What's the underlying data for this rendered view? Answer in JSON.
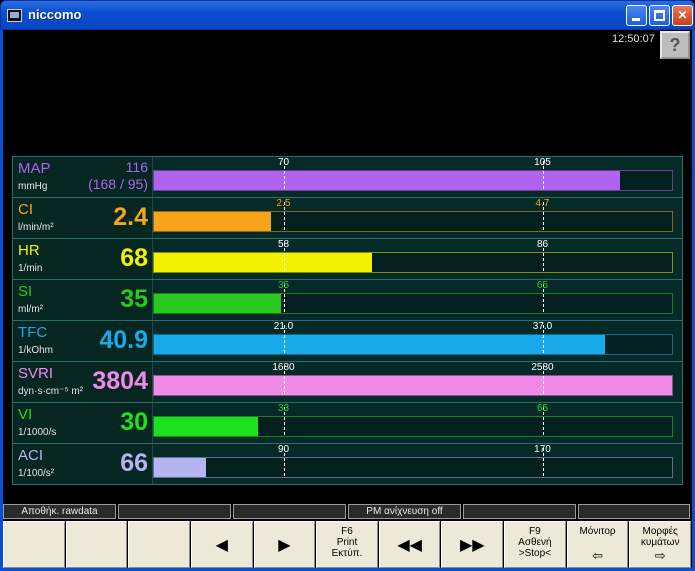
{
  "window": {
    "title": "niccomo"
  },
  "clock": "12:50:07",
  "help_label": "?",
  "parameters": [
    {
      "name": "MAP",
      "unit": "mmHg",
      "value": "116",
      "sub": "(168 / 95)",
      "color": "#b062f0",
      "thr1": "70",
      "thr2": "105",
      "fill_pct": 90,
      "thr1_pct": 25,
      "thr2_pct": 75
    },
    {
      "name": "CI",
      "unit": "l/min/m²",
      "value": "2.4",
      "color": "#f6a51a",
      "thr1": "2.5",
      "thr2": "4.7",
      "fill_pct": 22.5,
      "thr1_pct": 25,
      "thr2_pct": 75
    },
    {
      "name": "HR",
      "unit": "1/min",
      "value": "68",
      "color": "#f3f300",
      "thr1": "58",
      "thr2": "86",
      "fill_pct": 42,
      "thr1_pct": 25,
      "thr2_pct": 75
    },
    {
      "name": "SI",
      "unit": "ml/m²",
      "value": "35",
      "color": "#28c81e",
      "thr1": "35",
      "thr2": "65",
      "fill_pct": 24.5,
      "thr1_pct": 25,
      "thr2_pct": 75
    },
    {
      "name": "TFC",
      "unit": "1/kOhm",
      "value": "40.9",
      "color": "#18aaea",
      "thr1": "21.0",
      "thr2": "37.0",
      "fill_pct": 87,
      "thr1_pct": 25,
      "thr2_pct": 75
    },
    {
      "name": "SVRI",
      "unit": "dyn·s·cm⁻⁵ m²",
      "value": "3804",
      "color": "#f08ae8",
      "thr1": "1680",
      "thr2": "2580",
      "fill_pct": 100,
      "thr1_pct": 25,
      "thr2_pct": 75
    },
    {
      "name": "VI",
      "unit": "1/1000/s",
      "value": "30",
      "color": "#1ee01e",
      "thr1": "33",
      "thr2": "65",
      "fill_pct": 20,
      "thr1_pct": 25,
      "thr2_pct": 75
    },
    {
      "name": "ACI",
      "unit": "1/100/s²",
      "value": "66",
      "color": "#b4b4f0",
      "thr1": "90",
      "thr2": "170",
      "fill_pct": 10,
      "thr1_pct": 25,
      "thr2_pct": 75
    }
  ],
  "status_bar": [
    "Αποθήκ. rawdata",
    "",
    "",
    "PM ανίχνευση off",
    "",
    ""
  ],
  "function_keys": [
    {
      "label": "",
      "icon": ""
    },
    {
      "label": "",
      "icon": ""
    },
    {
      "label": "",
      "icon": ""
    },
    {
      "label": "",
      "icon": "◀"
    },
    {
      "label": "",
      "icon": "▶"
    },
    {
      "label": "F6\nPrint\nΕκτύπ.",
      "icon": ""
    },
    {
      "label": "",
      "icon": "◀◀"
    },
    {
      "label": "",
      "icon": "▶▶"
    },
    {
      "label": "F9\nΑσθενή\n>Stop<",
      "icon": ""
    },
    {
      "label": "Μόνιτορ",
      "icon": "⇦"
    },
    {
      "label": "Μορφές\nκυμάτων",
      "icon": "⇨"
    }
  ]
}
